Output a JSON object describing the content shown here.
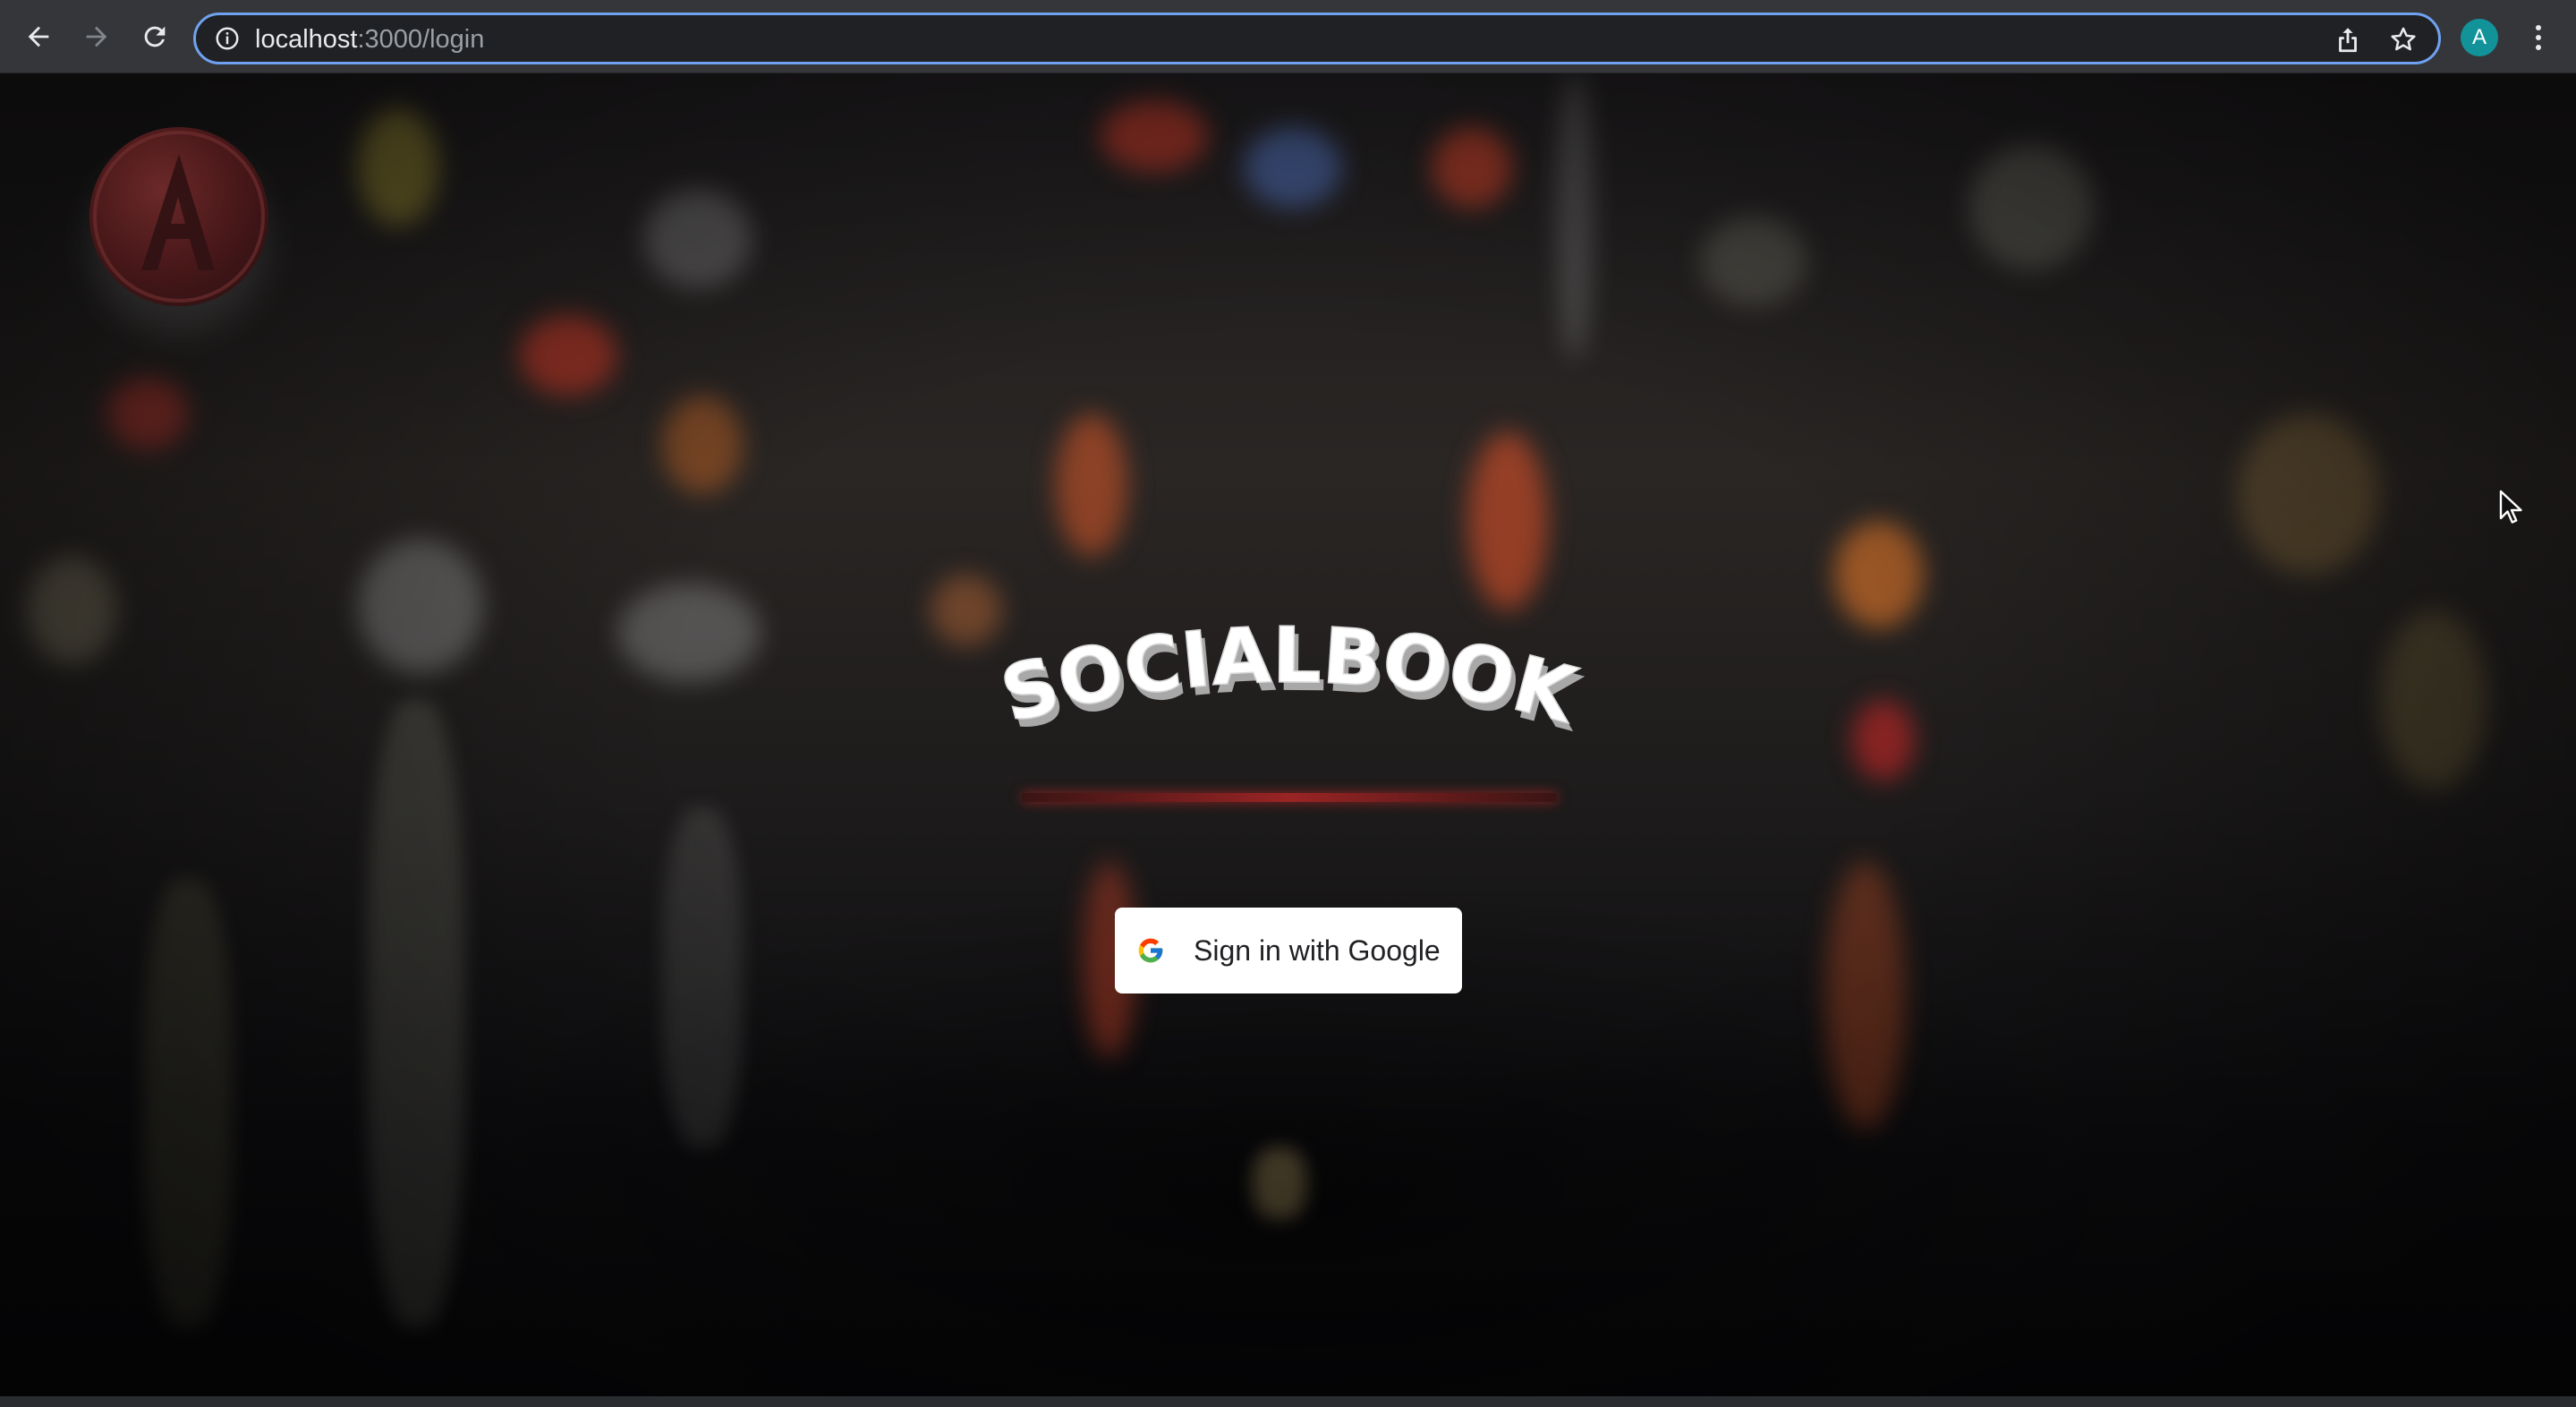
{
  "browser": {
    "url_host": "localhost",
    "url_path": ":3000/login",
    "profile_initial": "A",
    "icons": {
      "back": "arrow-left-icon",
      "forward": "arrow-right-icon",
      "reload": "reload-icon",
      "site_info": "info-icon",
      "share": "share-icon",
      "bookmark": "star-icon",
      "menu": "kebab-menu-icon"
    },
    "colors": {
      "chrome": "#35363a",
      "omnibox_focus": "#6fa2f2",
      "avatar": "#12939a"
    }
  },
  "page": {
    "brand_title": "SOCIALBOOK",
    "signin_label": "Sign in with Google",
    "colors": {
      "button_bg": "#ffffff",
      "brand_underline": "#9a2424"
    }
  }
}
